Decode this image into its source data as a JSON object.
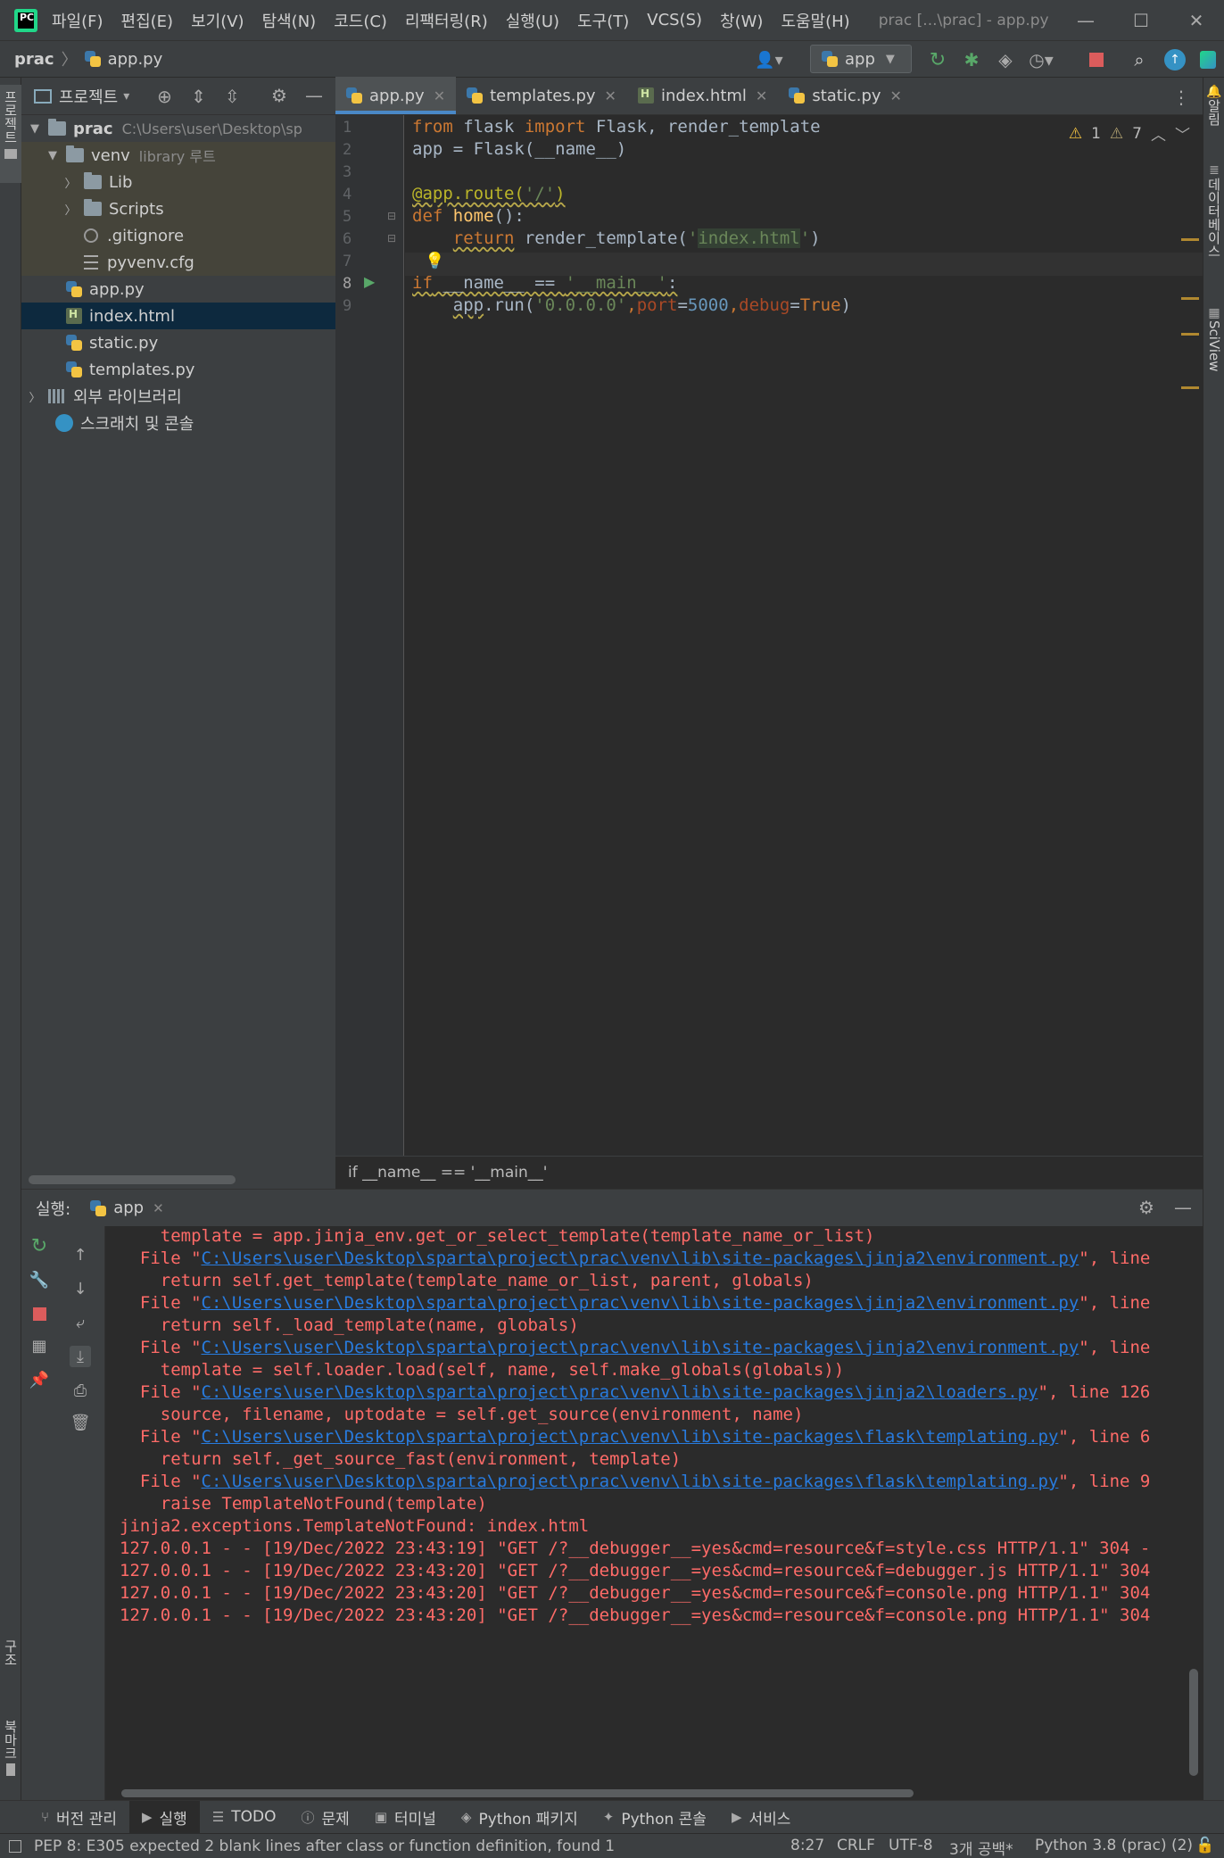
{
  "titlebar": {
    "menu": [
      "파일(F)",
      "편집(E)",
      "보기(V)",
      "탐색(N)",
      "코드(C)",
      "리팩터링(R)",
      "실행(U)",
      "도구(T)",
      "VCS(S)",
      "창(W)",
      "도움말(H)"
    ],
    "window_title": "prac [...\\prac] - app.py"
  },
  "navbar": {
    "root": "prac",
    "file": "app.py",
    "run_config": "app"
  },
  "left_strip": {
    "project_label": "프로젝트",
    "structure_label": "구조",
    "bookmarks_label": "북마크"
  },
  "right_strip": {
    "notifications_label": "알림",
    "database_label": "데이터베이스",
    "sciview_label": "SciView"
  },
  "project_panel": {
    "title": "프로젝트",
    "tree": [
      {
        "name": "prac",
        "hint": "C:\\Users\\user\\Desktop\\sp",
        "type": "folder",
        "expanded": true
      },
      {
        "name": "venv",
        "hint": "library 루트",
        "type": "folder",
        "expanded": true
      },
      {
        "name": "Lib",
        "type": "folder"
      },
      {
        "name": "Scripts",
        "type": "folder"
      },
      {
        "name": ".gitignore",
        "type": "git"
      },
      {
        "name": "pyvenv.cfg",
        "type": "cfg"
      },
      {
        "name": "app.py",
        "type": "py"
      },
      {
        "name": "index.html",
        "type": "html"
      },
      {
        "name": "static.py",
        "type": "py"
      },
      {
        "name": "templates.py",
        "type": "py"
      },
      {
        "name": "외부 라이브러리",
        "type": "lib"
      },
      {
        "name": "스크래치 및 콘솔",
        "type": "scratch"
      }
    ]
  },
  "editor": {
    "tabs": [
      {
        "label": "app.py",
        "active": true
      },
      {
        "label": "templates.py"
      },
      {
        "label": "index.html"
      },
      {
        "label": "static.py"
      }
    ],
    "warnings": "1",
    "weak_warnings": "7",
    "line_numbers": [
      "1",
      "2",
      "3",
      "4",
      "5",
      "6",
      "7",
      "8",
      "9"
    ],
    "breadcrumb": "if __name__ == '__main__'"
  },
  "run_panel": {
    "label": "실행:",
    "tab": "app",
    "lines": [
      {
        "text": "    template = app.jinja_env.get_or_select_template(template_name_or_list)"
      },
      {
        "pre": "  File \"",
        "link": "C:\\Users\\user\\Desktop\\sparta\\project\\prac\\venv\\lib\\site-packages\\jinja2\\environment.py",
        "post": "\", line"
      },
      {
        "text": "    return self.get_template(template_name_or_list, parent, globals)"
      },
      {
        "pre": "  File \"",
        "link": "C:\\Users\\user\\Desktop\\sparta\\project\\prac\\venv\\lib\\site-packages\\jinja2\\environment.py",
        "post": "\", line"
      },
      {
        "text": "    return self._load_template(name, globals)"
      },
      {
        "pre": "  File \"",
        "link": "C:\\Users\\user\\Desktop\\sparta\\project\\prac\\venv\\lib\\site-packages\\jinja2\\environment.py",
        "post": "\", line"
      },
      {
        "text": "    template = self.loader.load(self, name, self.make_globals(globals))"
      },
      {
        "pre": "  File \"",
        "link": "C:\\Users\\user\\Desktop\\sparta\\project\\prac\\venv\\lib\\site-packages\\jinja2\\loaders.py",
        "post": "\", line 126"
      },
      {
        "text": "    source, filename, uptodate = self.get_source(environment, name)"
      },
      {
        "pre": "  File \"",
        "link": "C:\\Users\\user\\Desktop\\sparta\\project\\prac\\venv\\lib\\site-packages\\flask\\templating.py",
        "post": "\", line 6"
      },
      {
        "text": "    return self._get_source_fast(environment, template)"
      },
      {
        "pre": "  File \"",
        "link": "C:\\Users\\user\\Desktop\\sparta\\project\\prac\\venv\\lib\\site-packages\\flask\\templating.py",
        "post": "\", line 9"
      },
      {
        "text": "    raise TemplateNotFound(template)"
      },
      {
        "text": "jinja2.exceptions.TemplateNotFound: index.html"
      },
      {
        "text": "127.0.0.1 - - [19/Dec/2022 23:43:19] \"GET /?__debugger__=yes&cmd=resource&f=style.css HTTP/1.1\" 304 -"
      },
      {
        "text": "127.0.0.1 - - [19/Dec/2022 23:43:20] \"GET /?__debugger__=yes&cmd=resource&f=debugger.js HTTP/1.1\" 304"
      },
      {
        "text": "127.0.0.1 - - [19/Dec/2022 23:43:20] \"GET /?__debugger__=yes&cmd=resource&f=console.png HTTP/1.1\" 304"
      },
      {
        "text": "127.0.0.1 - - [19/Dec/2022 23:43:20] \"GET /?__debugger__=yes&cmd=resource&f=console.png HTTP/1.1\" 304"
      }
    ]
  },
  "tool_windows": [
    {
      "label": "버전 관리",
      "icon": "branch-icon"
    },
    {
      "label": "실행",
      "icon": "run-icon",
      "active": true
    },
    {
      "label": "TODO",
      "icon": "list-icon"
    },
    {
      "label": "문제",
      "icon": "problem-icon"
    },
    {
      "label": "터미널",
      "icon": "terminal-icon"
    },
    {
      "label": "Python 패키지",
      "icon": "packages-icon"
    },
    {
      "label": "Python 콘솔",
      "icon": "python-icon"
    },
    {
      "label": "서비스",
      "icon": "services-icon"
    }
  ],
  "status_bar": {
    "message": "PEP 8: E305 expected 2 blank lines after class or function definition, found 1",
    "position": "8:27",
    "line_sep": "CRLF",
    "encoding": "UTF-8",
    "indent": "3개 공백*",
    "interpreter": "Python 3.8 (prac) (2)"
  },
  "colors": {
    "accent": "#4a88c7",
    "error_text": "#ff6b68",
    "link": "#287bde",
    "keyword": "#cc7832",
    "string": "#6a8759"
  }
}
